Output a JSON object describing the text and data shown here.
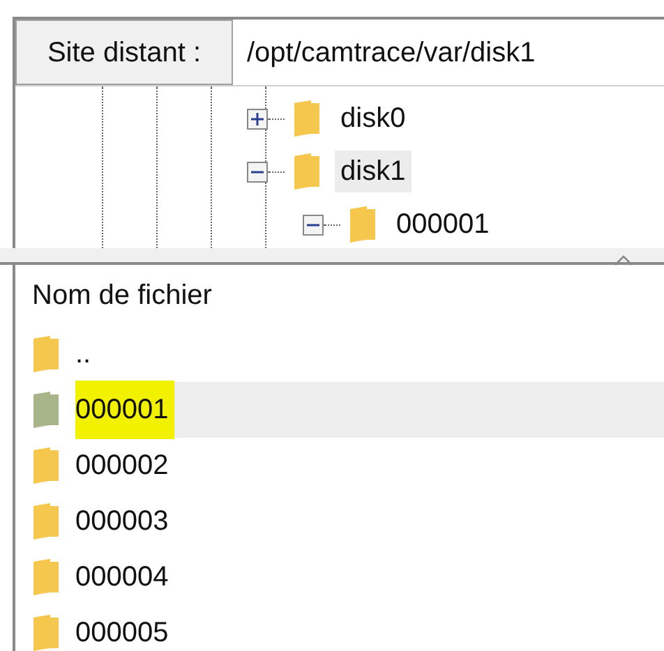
{
  "path_bar": {
    "label": "Site distant :",
    "value": "/opt/camtrace/var/disk1"
  },
  "tree": [
    {
      "label": "disk0",
      "expanded": false,
      "selected": false
    },
    {
      "label": "disk1",
      "expanded": true,
      "selected": true,
      "children": [
        {
          "label": "000001",
          "expanded": true,
          "selected": false
        }
      ]
    }
  ],
  "file_list": {
    "columns": [
      {
        "label": "Nom de fichier",
        "sorted": true
      }
    ],
    "rows": [
      {
        "name": "..",
        "selected": false,
        "highlighted": false
      },
      {
        "name": "000001",
        "selected": true,
        "highlighted": true
      },
      {
        "name": "000002",
        "selected": false,
        "highlighted": false
      },
      {
        "name": "000003",
        "selected": false,
        "highlighted": false
      },
      {
        "name": "000004",
        "selected": false,
        "highlighted": false
      },
      {
        "name": "000005",
        "selected": false,
        "highlighted": false
      }
    ]
  }
}
